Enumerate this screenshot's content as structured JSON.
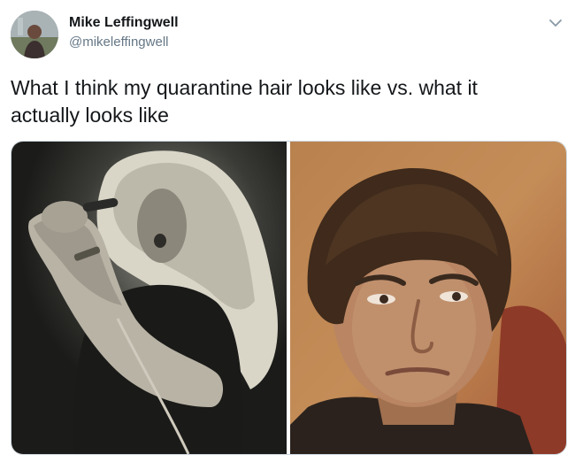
{
  "tweet": {
    "author": {
      "name": "Mike Leffingwell",
      "handle": "@mikeleffingwell"
    },
    "text": "What I think my quarantine hair looks like vs. what it actually looks like",
    "menu_icon": "chevron-down-icon"
  },
  "media": {
    "photos": [
      {
        "description_icon": "photo",
        "tone": "black-and-white"
      },
      {
        "description_icon": "photo",
        "tone": "warm-color"
      }
    ]
  },
  "colors": {
    "text_primary": "#14171a",
    "text_secondary": "#657786",
    "border": "#ccd6dd"
  }
}
